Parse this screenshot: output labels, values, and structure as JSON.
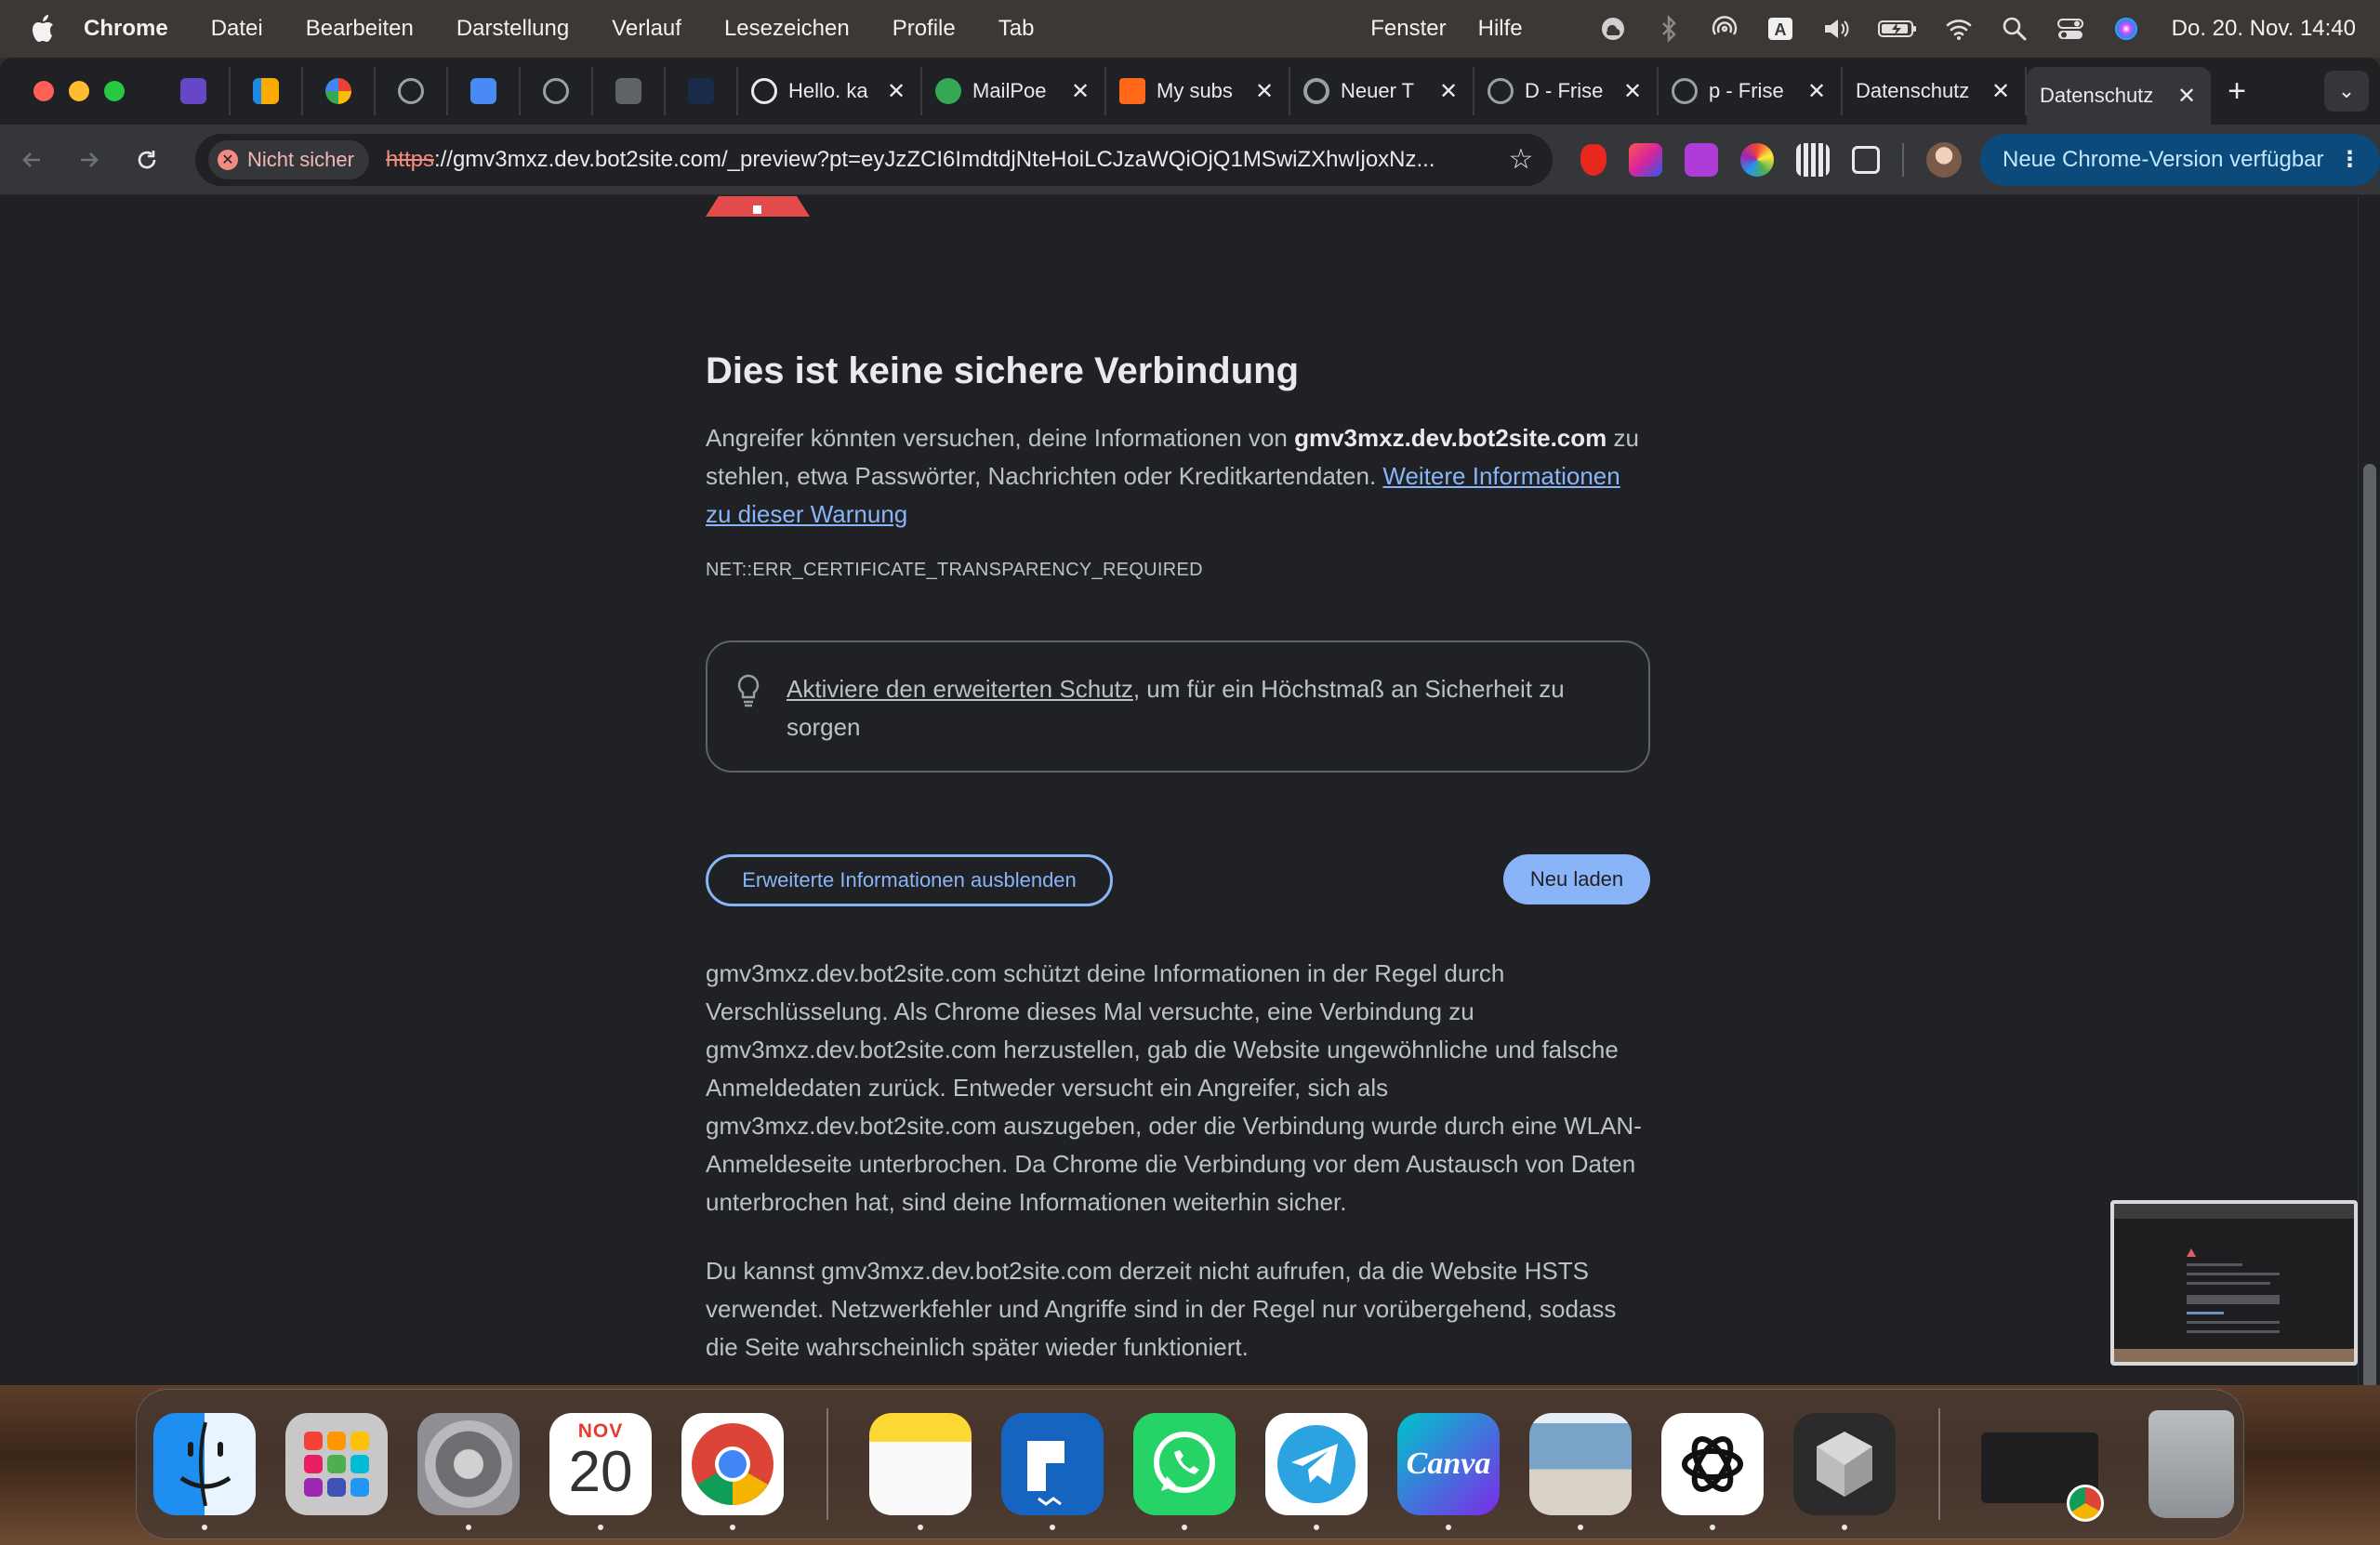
{
  "menubar": {
    "app": "Chrome",
    "items": [
      "Datei",
      "Bearbeiten",
      "Darstellung",
      "Verlauf",
      "Lesezeichen",
      "Profile",
      "Tab"
    ],
    "right_items": [
      "Fenster",
      "Hilfe"
    ],
    "clock": "Do. 20. Nov.  14:40",
    "status_icons": [
      "creative-cloud-icon",
      "bluetooth-icon",
      "airdrop-icon",
      "input-source-icon",
      "volume-icon",
      "battery-icon",
      "wifi-icon",
      "spotlight-icon",
      "control-center-icon",
      "siri-icon"
    ],
    "input_source_label": "A"
  },
  "browser": {
    "pinned_tabs": [
      {
        "icon": "hostinger-icon",
        "color": "#6747c7"
      },
      {
        "icon": "analytics-icon",
        "color": "#f9ab00"
      },
      {
        "icon": "colorful-circle-icon",
        "color": "#4285f4"
      },
      {
        "icon": "globe-icon",
        "color": "#9aa0a6"
      },
      {
        "icon": "blue-tag-icon",
        "color": "#4a8af4"
      },
      {
        "icon": "globe-icon",
        "color": "#9aa0a6"
      },
      {
        "icon": "check-icon",
        "color": "#5f6368"
      },
      {
        "icon": "wave-icon",
        "color": "#1a2a4a"
      }
    ],
    "tabs": [
      {
        "title": "Hello. ka",
        "icon": "hello-icon",
        "color": "#e8eaed"
      },
      {
        "title": "MailPoe",
        "icon": "mailpoet-icon",
        "color": "#34a853"
      },
      {
        "title": "My subs",
        "icon": "substack-icon",
        "color": "#ff6719"
      },
      {
        "title": "Neuer T",
        "icon": "chrome-icon",
        "color": "#9aa0a6"
      },
      {
        "title": "D - Frise",
        "icon": "globe-icon",
        "color": "#9aa0a6"
      },
      {
        "title": "p - Frise",
        "icon": "globe-icon",
        "color": "#9aa0a6"
      },
      {
        "title": "Datenschutz",
        "icon": "none",
        "color": "#202124"
      }
    ],
    "active_tab": {
      "title": "Datenschutz"
    },
    "security_chip": "Nicht sicher",
    "url_scheme": "https",
    "url_rest": "://gmv3mxz.dev.bot2site.com/_preview?pt=eyJzZCI6ImdtdjNteHoiLCJzaWQiOjQ1MSwiZXhwIjoxNz...",
    "update_chip": "Neue Chrome-Version verfügbar",
    "extensions": [
      {
        "icon": "adblock-icon",
        "color": "#e8271f"
      },
      {
        "icon": "instagram-icon",
        "color": "#c13584"
      },
      {
        "icon": "download-icon",
        "color": "#b03cd8"
      },
      {
        "icon": "colorpicker-icon",
        "color": "#4caf50"
      },
      {
        "icon": "qr-icon",
        "color": "#e8eaed"
      },
      {
        "icon": "puzzle-icon",
        "color": "#9aa0a6"
      }
    ]
  },
  "page": {
    "heading": "Dies ist keine sichere Verbindung",
    "intro_part1": "Angreifer könnten versuchen, deine Informationen von ",
    "intro_host": "gmv3mxz.dev.bot2site.com",
    "intro_part2": " zu stehlen, etwa Passwörter, Nachrichten oder Kreditkartendaten. ",
    "intro_link": "Weitere Informationen zu dieser Warnung",
    "error_code": "NET::ERR_CERTIFICATE_TRANSPARENCY_REQUIRED",
    "tip_link": "Aktiviere den erweiterten Schutz",
    "tip_rest": ", um für ein Höchstmaß an Sicherheit zu sorgen",
    "details_button": "Erweiterte Informationen ausblenden",
    "reload_button": "Neu laden",
    "details_1": "gmv3mxz.dev.bot2site.com schützt deine Informationen in der Regel durch Verschlüsselung. Als Chrome dieses Mal versuchte, eine Verbindung zu gmv3mxz.dev.bot2site.com herzustellen, gab die Website ungewöhnliche und falsche Anmeldedaten zurück. Entweder versucht ein Angreifer, sich als gmv3mxz.dev.bot2site.com auszugeben, oder die Verbindung wurde durch eine WLAN-Anmeldeseite unterbrochen. Da Chrome die Verbindung vor dem Austausch von Daten unterbrochen hat, sind deine Informationen weiterhin sicher.",
    "details_2": "Du kannst gmv3mxz.dev.bot2site.com derzeit nicht aufrufen, da die Website HSTS verwendet. Netzwerkfehler und Angriffe sind in der Regel nur vorübergehend, sodass die Seite wahrscheinlich später wieder funktioniert."
  },
  "dock": {
    "apps": [
      {
        "name": "finder",
        "icon": "finder-icon",
        "color": "#1e8ef0",
        "running": true
      },
      {
        "name": "launchpad",
        "icon": "launchpad-icon",
        "color": "#c8c8c8",
        "running": false
      },
      {
        "name": "system-settings",
        "icon": "settings-gear-icon",
        "color": "#8e8e93",
        "running": true
      },
      {
        "name": "calendar",
        "icon": "calendar-icon",
        "color": "#ffffff",
        "running": true
      },
      {
        "name": "chrome",
        "icon": "chrome-icon",
        "color": "#ffffff",
        "running": true
      },
      {
        "name": "notes",
        "icon": "notes-icon",
        "color": "#fdd835",
        "running": true
      },
      {
        "name": "wunderbucket",
        "icon": "blue-tile-icon",
        "color": "#1565c0",
        "running": true
      },
      {
        "name": "whatsapp",
        "icon": "whatsapp-icon",
        "color": "#25d366",
        "running": true
      },
      {
        "name": "telegram",
        "icon": "telegram-icon",
        "color": "#ffffff",
        "running": true
      },
      {
        "name": "canva",
        "icon": "canva-icon",
        "color": "#7d2ae8",
        "running": true
      },
      {
        "name": "preview",
        "icon": "preview-icon",
        "color": "#c9d6e3",
        "running": true
      },
      {
        "name": "chatgpt",
        "icon": "chatgpt-icon",
        "color": "#ffffff",
        "running": true
      },
      {
        "name": "cube-app",
        "icon": "cube-icon",
        "color": "#2b2b2b",
        "running": true
      }
    ],
    "calendar_month": "NOV",
    "calendar_day": "20",
    "canva_label": "Canva",
    "minimized": {
      "name": "chrome-window",
      "icon": "window-thumbnail-icon"
    },
    "trash": {
      "name": "trash",
      "icon": "trash-icon"
    }
  }
}
